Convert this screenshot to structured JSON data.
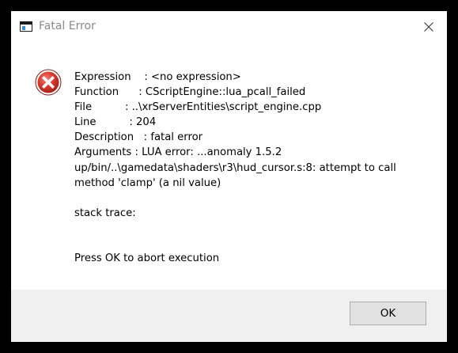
{
  "window": {
    "title": "Fatal Error",
    "close_glyph": "×"
  },
  "icons": {
    "app": "app-window-icon",
    "error": "error-icon",
    "close": "close-icon"
  },
  "colors": {
    "error_red": "#d63a2f",
    "button_bg": "#e1e1e1",
    "footer_bg": "#f0f0f0"
  },
  "message": {
    "expression": "Expression    : <no expression>",
    "function": "Function      : CScriptEngine::lua_pcall_failed",
    "file": "File          : ..\\xrServerEntities\\script_engine.cpp",
    "line": "Line          : 204",
    "description": "Description   : fatal error",
    "arguments": "Arguments     : LUA error: ...anomaly 1.5.2 up/bin/..\\gamedata\\shaders\\r3\\hud_cursor.s:8: attempt to call method 'clamp' (a nil value)",
    "stack_trace": "stack trace:",
    "prompt": "Press OK to abort execution"
  },
  "buttons": {
    "ok": "OK"
  }
}
